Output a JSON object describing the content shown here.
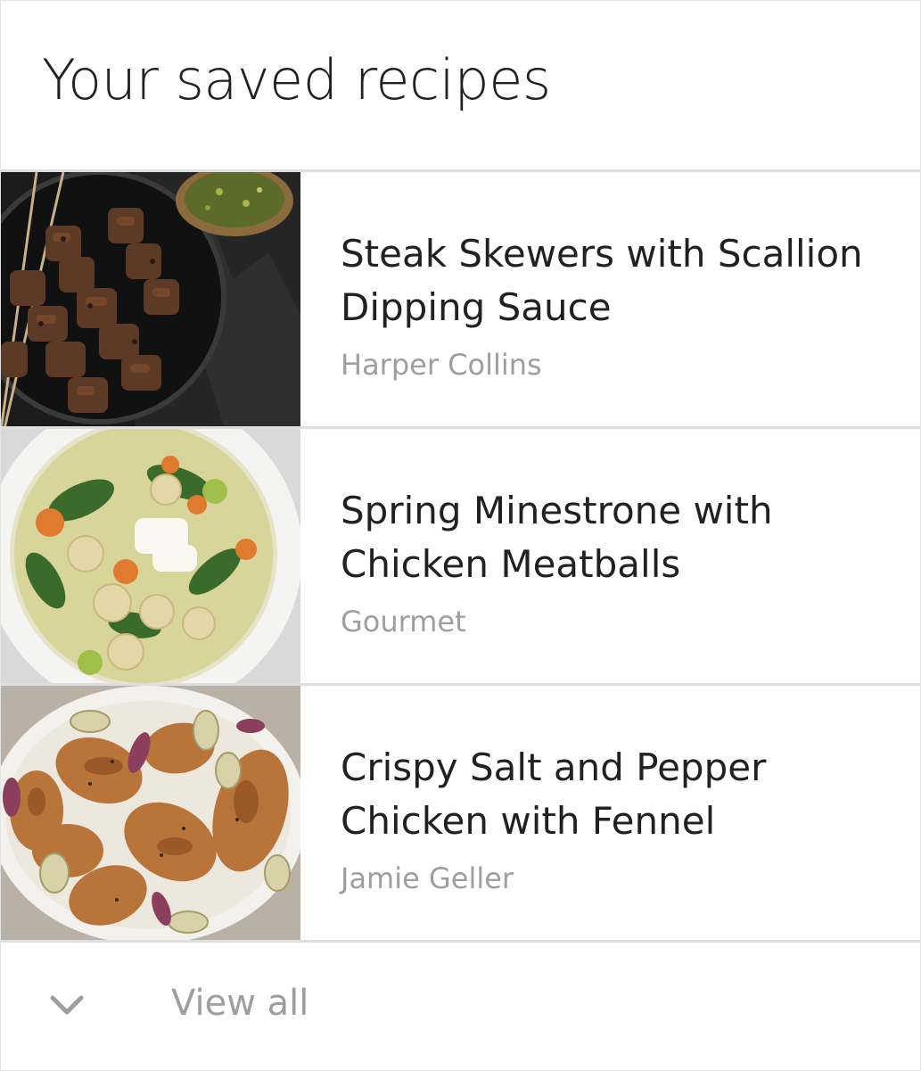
{
  "header": {
    "title": "Your saved recipes"
  },
  "recipes": [
    {
      "title": "Steak Skewers with Scallion Dipping Sauce",
      "source": "Harper Collins",
      "image": "steak-skewers-photo"
    },
    {
      "title": "Spring Minestrone with Chicken Meatballs",
      "source": "Gourmet",
      "image": "minestrone-soup-photo"
    },
    {
      "title": "Crispy Salt and Pepper Chicken with Fennel",
      "source": "Jamie Geller",
      "image": "roast-chicken-photo"
    }
  ],
  "footer": {
    "view_all_label": "View all",
    "icon": "chevron-down-icon"
  },
  "colors": {
    "title_text": "#212121",
    "secondary_text": "#9e9e9e",
    "divider": "#dedede",
    "background": "#ffffff"
  }
}
